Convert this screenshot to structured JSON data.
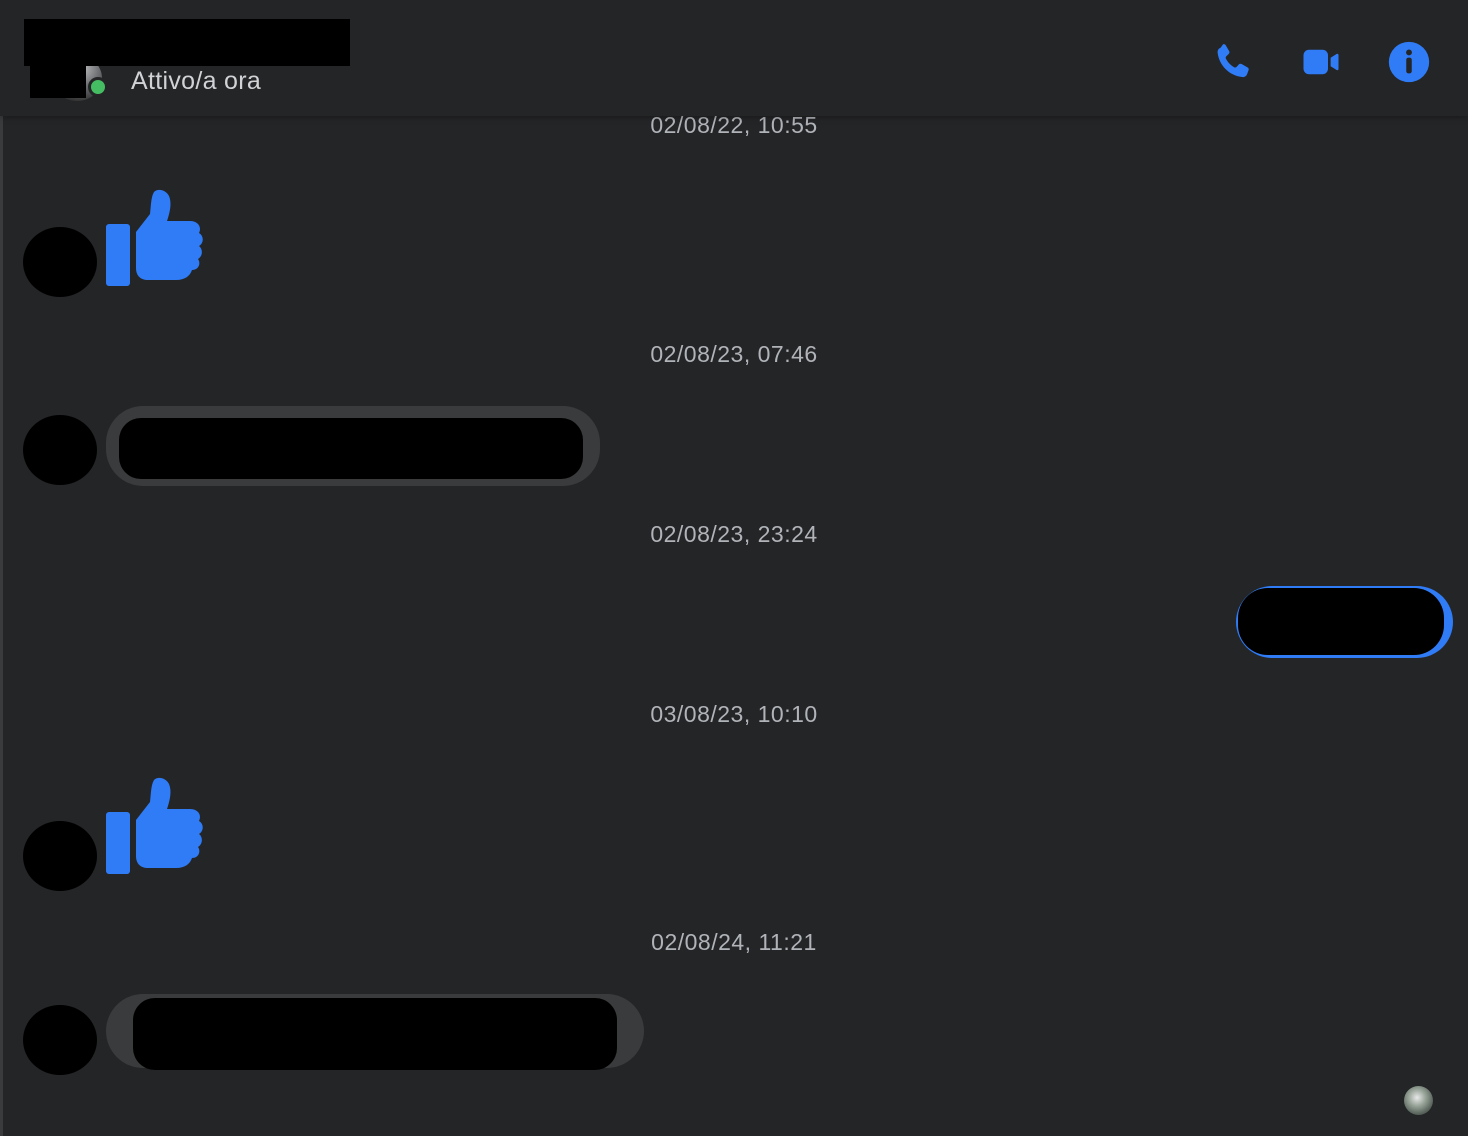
{
  "header": {
    "status_text": "Attivo/a ora",
    "online_color": "#45bd62",
    "accent_color": "#2f7cf6",
    "actions": [
      {
        "name": "phone-icon",
        "label": "Chiamata vocale"
      },
      {
        "name": "video-camera-icon",
        "label": "Videochiamata"
      },
      {
        "name": "info-icon",
        "label": "Informazioni conversazione"
      }
    ]
  },
  "conversation": {
    "timestamps": [
      "02/08/22, 10:55",
      "02/08/23, 07:46",
      "02/08/23, 23:24",
      "03/08/23, 10:10",
      "02/08/24, 11:21"
    ],
    "messages": [
      {
        "type": "like",
        "from": "contact",
        "icon": "thumbs-up-icon"
      },
      {
        "type": "text",
        "from": "contact",
        "content": "redacted"
      },
      {
        "type": "text",
        "from": "me",
        "content": "redacted"
      },
      {
        "type": "like",
        "from": "contact",
        "icon": "thumbs-up-icon"
      },
      {
        "type": "text",
        "from": "contact",
        "content": "redacted"
      }
    ]
  }
}
